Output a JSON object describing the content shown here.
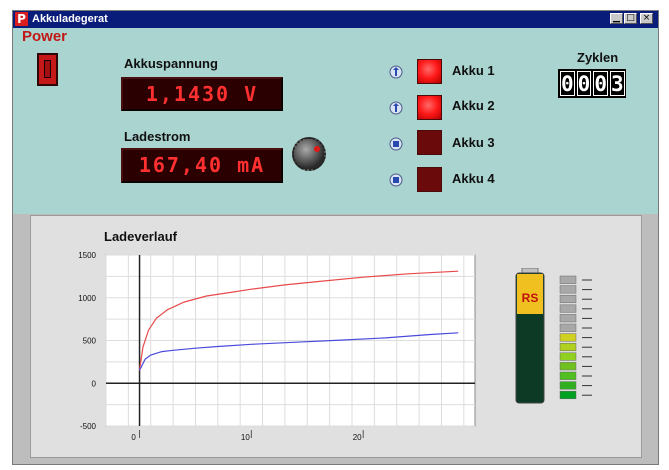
{
  "window": {
    "title": "Akkuladegerat",
    "controls": [
      "▁",
      "□",
      "×"
    ]
  },
  "power": {
    "label": "Power",
    "state": "off"
  },
  "akkuspannung": {
    "label": "Akkuspannung",
    "value": "1,1430  V"
  },
  "ladestrom": {
    "label": "Ladestrom",
    "value": "167,40  mA"
  },
  "akkus": [
    {
      "label": "Akku 1",
      "active": true
    },
    {
      "label": "Akku 2",
      "active": true
    },
    {
      "label": "Akku 3",
      "active": false
    },
    {
      "label": "Akku 4",
      "active": false
    }
  ],
  "zyklen": {
    "label": "Zyklen",
    "digits": [
      "0",
      "0",
      "0",
      "3"
    ]
  },
  "colors": {
    "title_bar": "#0a1c7a",
    "top_panel": "#aad4cf",
    "lcd_background": "#2a0000",
    "lcd_text": "#ff3030",
    "led_on": "#ff1818",
    "led_off": "#6a0a0a",
    "voltage_curve": "#e84a4a",
    "current_curve": "#4a4adc"
  },
  "chart_data": {
    "type": "line",
    "title": "Ladeverlauf",
    "xlabel": "",
    "ylabel": "",
    "xlim": [
      -3,
      30
    ],
    "ylim": [
      -500,
      1500
    ],
    "x_ticks": [
      0,
      10,
      20
    ],
    "y_ticks": [
      -500,
      0,
      500,
      1000,
      1500
    ],
    "grid": true,
    "series": [
      {
        "color": "#e84a4a",
        "x": [
          0,
          0.3,
          0.8,
          1.5,
          2.5,
          4,
          6,
          8,
          10,
          13,
          16,
          20,
          24,
          28.5
        ],
        "y": [
          150,
          420,
          620,
          760,
          860,
          950,
          1020,
          1060,
          1100,
          1150,
          1190,
          1240,
          1280,
          1310
        ]
      },
      {
        "color": "#4a4adc",
        "x": [
          0,
          0.5,
          1,
          2,
          3,
          5,
          7,
          10,
          14,
          18,
          22,
          26,
          28.5
        ],
        "y": [
          150,
          280,
          330,
          370,
          385,
          410,
          430,
          455,
          480,
          505,
          530,
          570,
          590
        ]
      }
    ]
  },
  "battery_gauge": {
    "label_top": "RS",
    "level": 0.55,
    "segments": 13
  }
}
